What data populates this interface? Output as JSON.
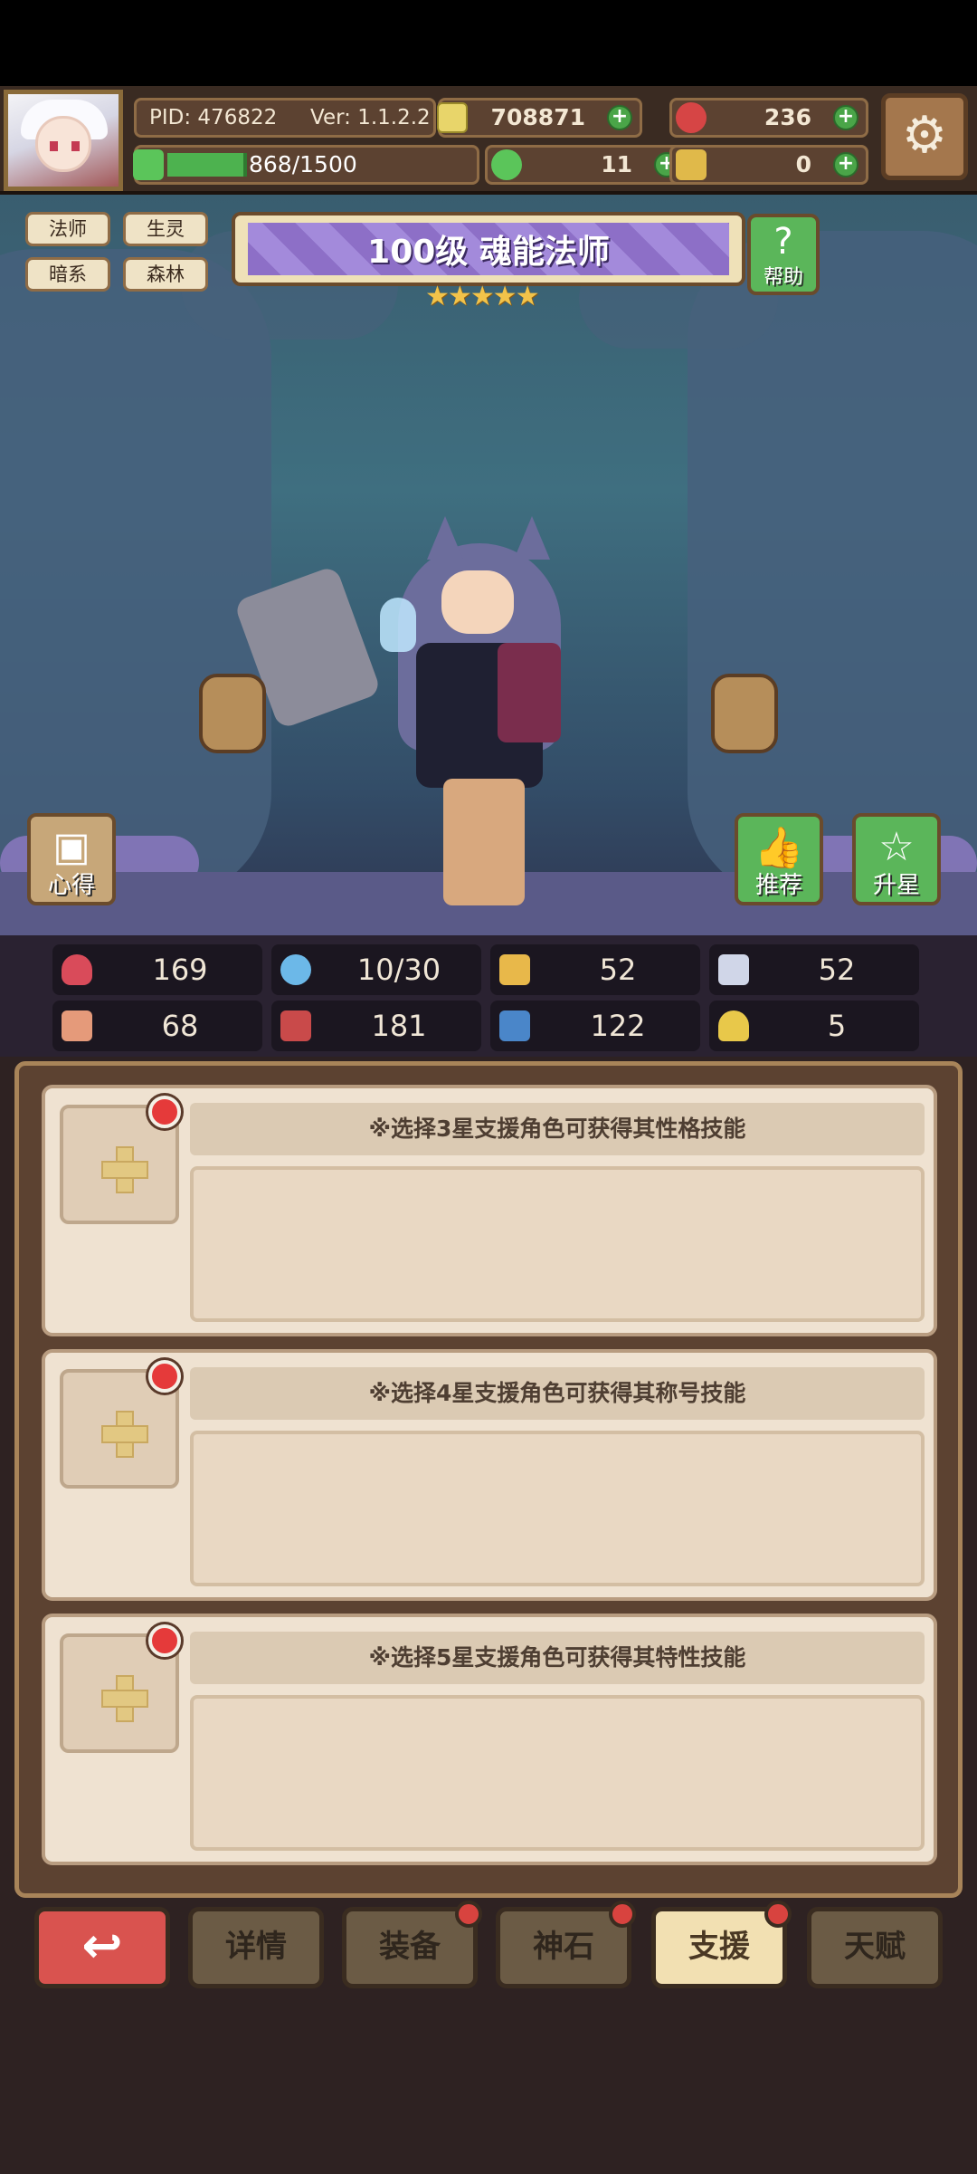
{
  "header": {
    "pid": "PID: 476822",
    "version": "Ver: 1.1.2.2",
    "exp": "868/1500",
    "gold": "708871",
    "gems": "236",
    "clover": "11",
    "keys": "0"
  },
  "tags": [
    "法师",
    "生灵",
    "暗系",
    "森林"
  ],
  "hero": {
    "title": "100级  魂能法师",
    "stars": "★★★★★",
    "star_count": 5
  },
  "side_buttons": {
    "help": "帮助",
    "notes": "心得",
    "recommend": "推荐",
    "star_up": "升星"
  },
  "stats": [
    {
      "icon": "heart-icon",
      "value": "169",
      "color": "#d94b5a"
    },
    {
      "icon": "water-drop-icon",
      "value": "10/30",
      "color": "#6cb8e8"
    },
    {
      "icon": "shield-icon",
      "value": "52",
      "color": "#e8b84a"
    },
    {
      "icon": "wing-icon",
      "value": "52",
      "color": "#d0d6e8"
    },
    {
      "icon": "fist-icon",
      "value": "68",
      "color": "#e59a7a"
    },
    {
      "icon": "book-icon",
      "value": "181",
      "color": "#c94a4a"
    },
    {
      "icon": "boot-icon",
      "value": "122",
      "color": "#4a86c9"
    },
    {
      "icon": "horseshoe-icon",
      "value": "5",
      "color": "#e8c84a"
    }
  ],
  "support_cards": [
    {
      "hint": "※选择3星支援角色可获得其性格技能"
    },
    {
      "hint": "※选择4星支援角色可获得其称号技能"
    },
    {
      "hint": "※选择5星支援角色可获得其特性技能"
    }
  ],
  "tabs": {
    "back": "↩",
    "details": "详情",
    "equipment": "装备",
    "divine_stone": "神石",
    "support": "支援",
    "talent": "天赋"
  }
}
